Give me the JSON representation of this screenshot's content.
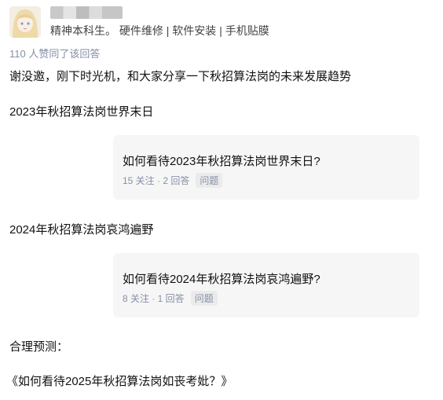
{
  "author": {
    "bio": "精神本科生。 硬件维修 | 软件安装 | 手机贴膜"
  },
  "votes_text": "110 人赞同了该回答",
  "answer": {
    "intro": "谢没邀，刚下时光机，和大家分享一下秋招算法岗的未来发展趋势",
    "section_2023": "2023年秋招算法岗世界末日",
    "section_2024": "2024年秋招算法岗哀鸿遍野",
    "prediction_label": "合理预测：",
    "prediction_text": "《如何看待2025年秋招算法岗如丧考妣？》"
  },
  "question_cards": [
    {
      "title": "如何看待2023年秋招算法岗世界末日?",
      "stats": "15 关注 · 2 回答",
      "tag": "问题"
    },
    {
      "title": "如何看待2024年秋招算法岗哀鸿遍野?",
      "stats": "8 关注 · 1 回答",
      "tag": "问题"
    }
  ]
}
